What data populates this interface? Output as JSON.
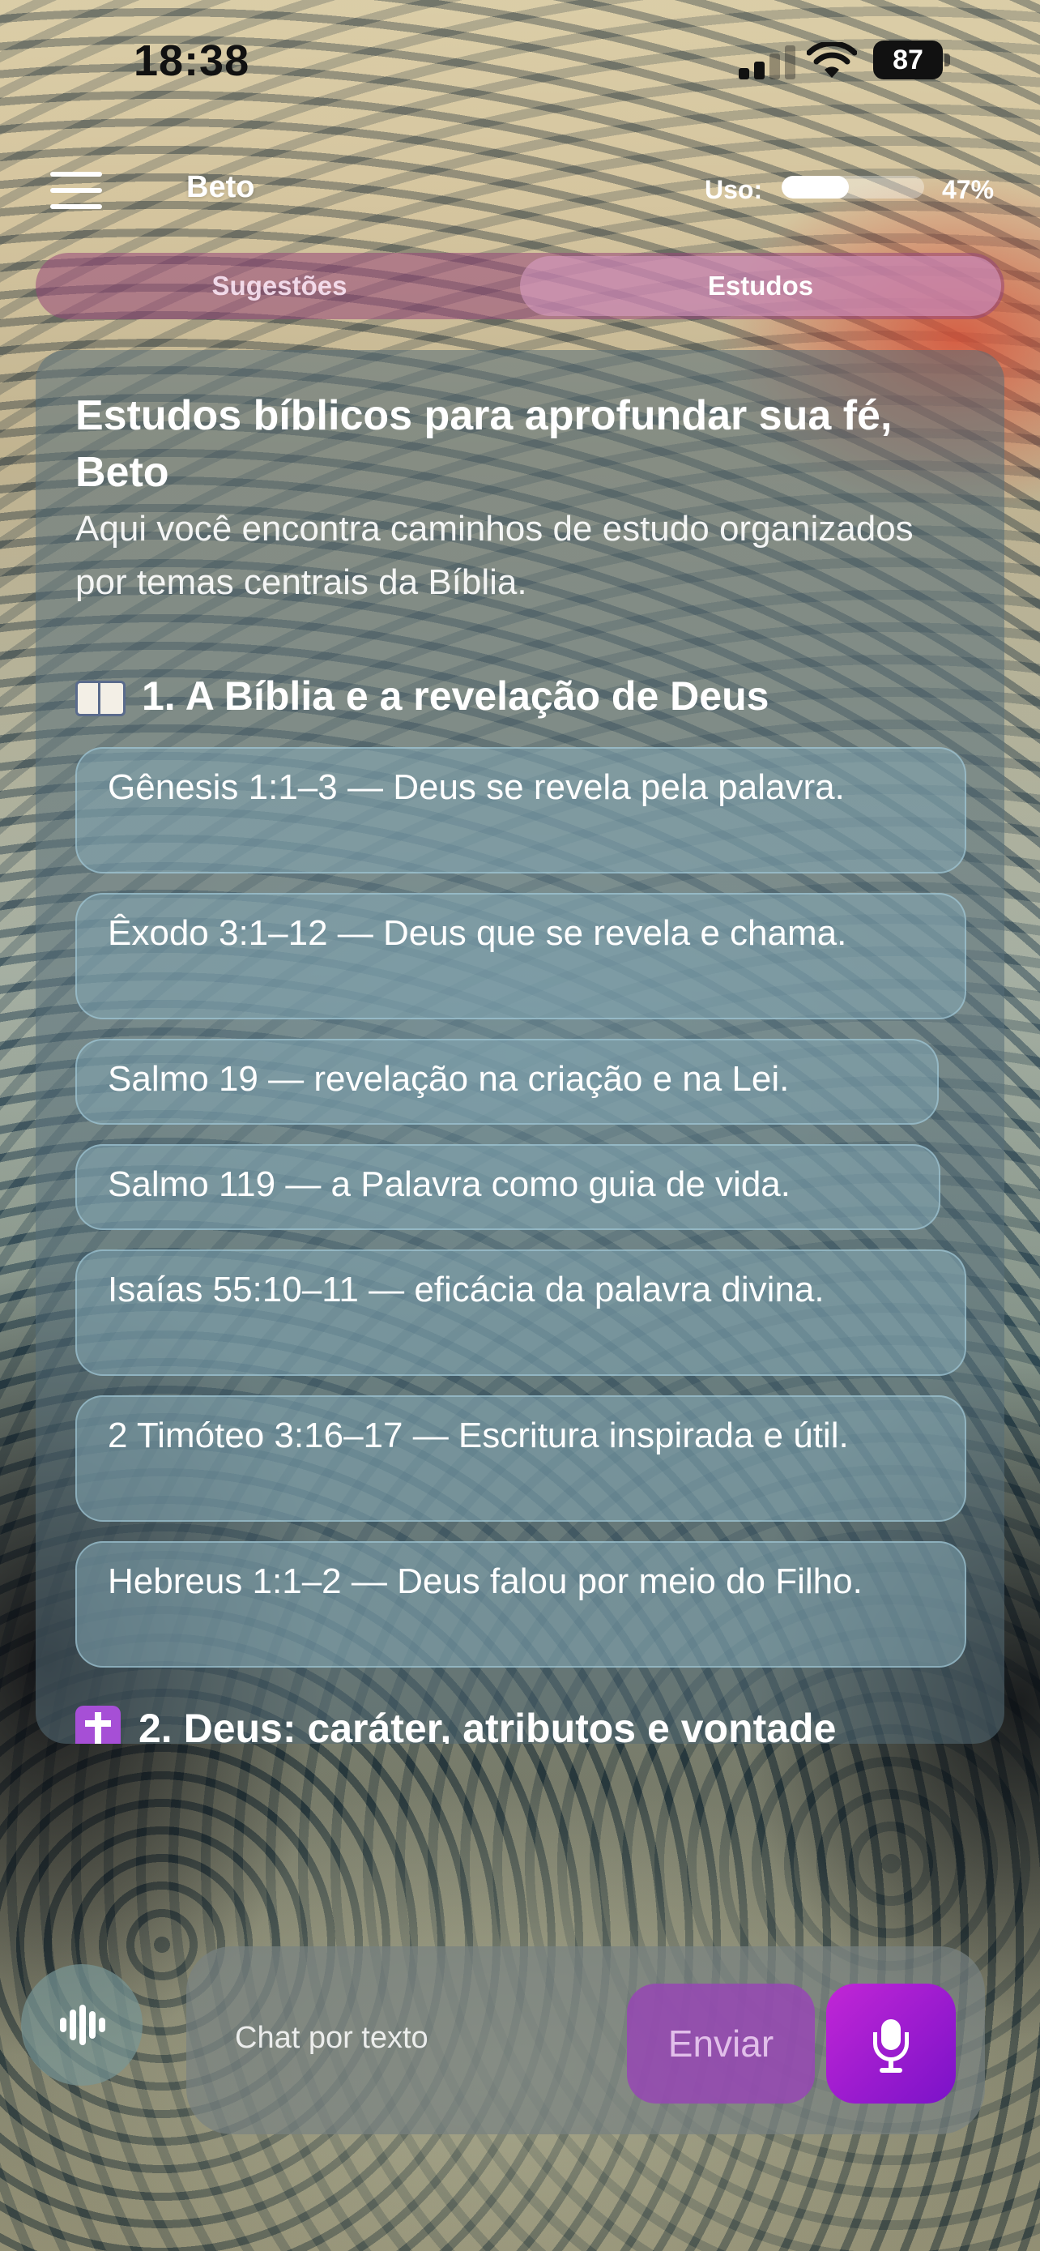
{
  "status_bar": {
    "time": "18:38",
    "battery": "87"
  },
  "header": {
    "user_name": "Beto",
    "usage_label": "Uso:",
    "usage_percent": "47%",
    "usage_fraction": 0.47
  },
  "tabs": [
    {
      "label": "Sugestões",
      "active": false
    },
    {
      "label": "Estudos",
      "active": true
    }
  ],
  "card": {
    "title": "Estudos bíblicos para aprofundar sua fé, Beto",
    "subtitle": "Aqui você encontra caminhos de estudo organizados por temas centrais da Bíblia.",
    "sections": [
      {
        "icon": "open-book-icon",
        "heading": "1. A Bíblia e a revelação de Deus",
        "items": [
          "Gênesis 1:1–3 — Deus se revela pela palavra.",
          "Êxodo 3:1–12 — Deus que se revela e chama.",
          "Salmo 19 — revelação na criação e na Lei.",
          "Salmo 119 — a Palavra como guia de vida.",
          "Isaías 55:10–11 — eficácia da palavra divina.",
          "2 Timóteo 3:16–17 — Escritura inspirada e útil.",
          "Hebreus 1:1–2 — Deus falou por meio do Filho."
        ]
      },
      {
        "icon": "cross-icon",
        "heading": "2. Deus: caráter, atributos e vontade"
      }
    ]
  },
  "composer": {
    "placeholder": "Chat por texto",
    "send_label": "Enviar"
  },
  "colors": {
    "accent_purple": "#a020d0",
    "tab_bar": "#96467a"
  }
}
